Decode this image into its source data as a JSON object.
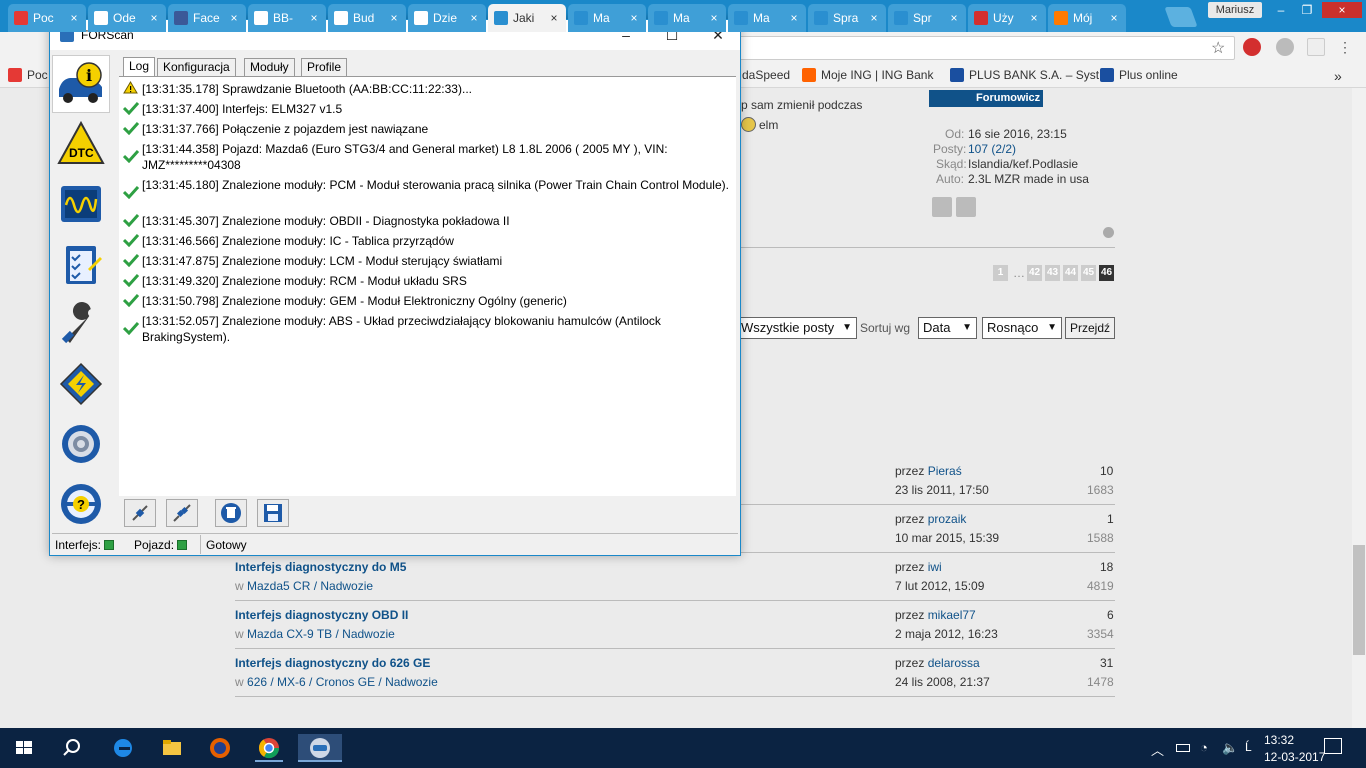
{
  "browser": {
    "tabs": [
      {
        "label": "Poc",
        "color": "#e53935",
        "icon": "wp-icon"
      },
      {
        "label": "Ode",
        "color": "#ffffff",
        "icon": "gmail-icon"
      },
      {
        "label": "Face",
        "color": "#3b5998",
        "icon": "facebook-icon"
      },
      {
        "label": "BB-",
        "color": "#ffffff",
        "icon": "doc-icon"
      },
      {
        "label": "Bud",
        "color": "#ffffff",
        "icon": "doc-icon"
      },
      {
        "label": "Dzie",
        "color": "#ffffff",
        "icon": "doc-icon"
      },
      {
        "label": "Jaki",
        "color": "#2a8fd0",
        "icon": "forum-icon"
      },
      {
        "label": "Ma",
        "color": "#2a8fd0",
        "icon": "forum-icon"
      },
      {
        "label": "Ma",
        "color": "#2a8fd0",
        "icon": "forum-icon"
      },
      {
        "label": "Ma",
        "color": "#2a8fd0",
        "icon": "forum-icon"
      },
      {
        "label": "Spra",
        "color": "#2a8fd0",
        "icon": "forum-icon"
      },
      {
        "label": "Spr",
        "color": "#2a8fd0",
        "icon": "forum-icon"
      },
      {
        "label": "Uży",
        "color": "#d32f2f",
        "icon": "opera-icon"
      },
      {
        "label": "Mój",
        "color": "#ff7a00",
        "icon": "olx-icon"
      }
    ],
    "profile": "Mariusz",
    "close_icon": "×",
    "star_icon": "☆",
    "back_icon": "←",
    "more_icon": "»",
    "bookmarks": [
      {
        "label": "Poc",
        "color": "#e53935"
      },
      {
        "label": "daSpeed",
        "color": "#ffffff"
      },
      {
        "label": "Moje ING | ING Bank",
        "color": "#ff6200"
      },
      {
        "label": "PLUS BANK S.A. – Syst",
        "color": "#1a4fa0"
      },
      {
        "label": "Plus online",
        "color": "#1a4fa0"
      }
    ]
  },
  "forum": {
    "post_snippet_1": "p sam zmienił podczas",
    "post_snippet_2": "elm",
    "author_rank": "Forumowicz",
    "profile": {
      "od_label": "Od:",
      "od_value": "16 sie 2016, 23:15",
      "posty_label": "Posty:",
      "posty_value": "107 (2/2)",
      "skad_label": "Skąd:",
      "skad_value": "Islandia/kef.Podlasie",
      "auto_label": "Auto:",
      "auto_value": "2.3L MZR made in usa"
    },
    "pagination": {
      "first": "1",
      "ellipsis": "…",
      "pages": [
        "42",
        "43",
        "44",
        "45"
      ],
      "current": "46"
    },
    "filter": {
      "show": "Wszystkie posty",
      "sort_label": "Sortuj wg",
      "sort_by": "Data",
      "order": "Rosnąco",
      "go": "Przejdź"
    },
    "topics": [
      {
        "title": "",
        "forum_prefix": "",
        "forum": "",
        "by": "przez",
        "author": "Pieraś",
        "date": "23 lis 2011, 17:50",
        "replies": "10",
        "views": "1683"
      },
      {
        "title": "",
        "forum_prefix": "",
        "forum": "",
        "by": "przez",
        "author": "prozaik",
        "date": "10 mar 2015, 15:39",
        "replies": "1",
        "views": "1588"
      },
      {
        "title": "Interfejs diagnostyczny do M5",
        "forum_prefix": "w",
        "forum": "Mazda5 CR / Nadwozie",
        "by": "przez",
        "author": "iwi",
        "date": "7 lut 2012, 15:09",
        "replies": "18",
        "views": "4819"
      },
      {
        "title": "Interfejs diagnostyczny OBD II",
        "forum_prefix": "w",
        "forum": "Mazda CX-9 TB / Nadwozie",
        "by": "przez",
        "author": "mikael77",
        "date": "2 maja 2012, 16:23",
        "replies": "6",
        "views": "3354"
      },
      {
        "title": "Interfejs diagnostyczny do 626 GE",
        "forum_prefix": "w",
        "forum": "626 / MX-6 / Cronos GE / Nadwozie",
        "by": "przez",
        "author": "delarossa",
        "date": "24 lis 2008, 21:37",
        "replies": "31",
        "views": "1478"
      }
    ]
  },
  "forscan": {
    "title": "FORScan",
    "controls": {
      "minimize": "–",
      "maximize": "☐",
      "close": "✕"
    },
    "tabs": [
      "Log",
      "Konfiguracja",
      "Moduły",
      "Profile"
    ],
    "log": [
      {
        "status": "warning",
        "text": "[13:31:35.178] Sprawdzanie Bluetooth (AA:BB:CC:11:22:33)..."
      },
      {
        "status": "ok",
        "text": "[13:31:37.400] Interfejs:  ELM327 v1.5"
      },
      {
        "status": "ok",
        "text": "[13:31:37.766] Połączenie z pojazdem jest nawiązane"
      },
      {
        "status": "ok",
        "text": "[13:31:44.358] Pojazd: Mazda6 (Euro STG3/4 and General market) L8 1.8L 2006 ( 2005 MY ), VIN: JMZ*********04308"
      },
      {
        "status": "ok",
        "text": "[13:31:45.180] Znalezione moduły:  PCM - Moduł sterowania pracą silnika (Power Train Chain Control Module)."
      },
      {
        "status": "ok",
        "text": "[13:31:45.307] Znalezione moduły:  OBDII - Diagnostyka pokładowa II"
      },
      {
        "status": "ok",
        "text": "[13:31:46.566] Znalezione moduły:  IC - Tablica przyrządów"
      },
      {
        "status": "ok",
        "text": "[13:31:47.875] Znalezione moduły:  LCM - Moduł sterujący światłami"
      },
      {
        "status": "ok",
        "text": "[13:31:49.320] Znalezione moduły:  RCM - Moduł układu SRS"
      },
      {
        "status": "ok",
        "text": "[13:31:50.798] Znalezione moduły:  GEM - Moduł Elektroniczny Ogólny (generic)"
      },
      {
        "status": "ok",
        "text": "[13:31:52.057] Znalezione moduły:  ABS - Układ przeciwdziałający blokowaniu hamulców (Antilock BrakingSystem)."
      }
    ],
    "status_bar": {
      "interface_label": "Interfejs:",
      "vehicle_label": "Pojazd:",
      "state": "Gotowy",
      "led_color": "#2ea043"
    },
    "sidebar_dtc_label": "DTC"
  },
  "taskbar": {
    "time": "13:32",
    "date": "12-03-2017"
  }
}
